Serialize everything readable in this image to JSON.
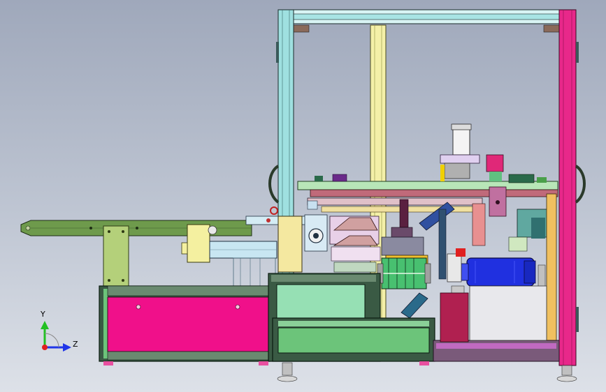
{
  "viewport": {
    "background_top": "#9fa8bb",
    "background_bottom": "#dde1e8"
  },
  "triad": {
    "y_label": "Y",
    "z_label": "Z",
    "y_color": "#22c022",
    "z_color": "#2036e8",
    "origin_color": "#e02020"
  },
  "colors": {
    "frame_cyan": "#9fe0e0",
    "frame_magenta": "#e8288a",
    "frame_yellow": "#f4f0a8",
    "conveyor_green": "#6e9a4c",
    "bracket_green": "#b4d07a",
    "cabinet_pink": "#f0108a",
    "cabinet_green": "#6cc47a",
    "panel_mint": "#96e0b4",
    "motor_blue": "#2030e0",
    "plate_lightblue": "#c8e6f2",
    "dark_frame": "#3a5a44",
    "orange_block": "#f0c030"
  }
}
